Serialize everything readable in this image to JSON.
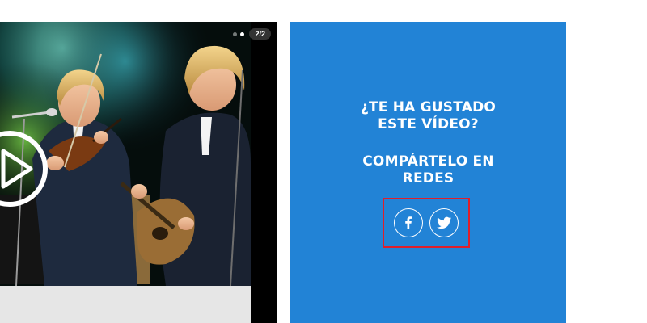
{
  "video": {
    "slide_counter": "2/2",
    "play_icon": "play-icon"
  },
  "share": {
    "question_line1": "¿TE HA GUSTADO",
    "question_line2": "ESTE VÍDEO?",
    "cta_line1": "COMPÁRTELO EN",
    "cta_line2": "REDES",
    "buttons": [
      {
        "icon": "facebook-icon"
      },
      {
        "icon": "twitter-icon"
      }
    ],
    "highlight_color": "#e01e2b"
  },
  "colors": {
    "panel_blue": "#2283d6",
    "video_bg": "#000000",
    "caption_strip": "#e6e6e6"
  }
}
